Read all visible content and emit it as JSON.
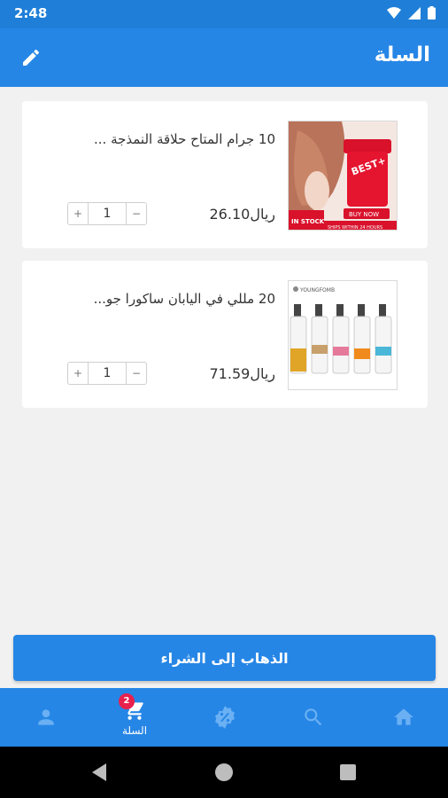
{
  "status_bar": {
    "time": "2:48"
  },
  "app_bar": {
    "title": "السلة",
    "edit_icon": "pencil-icon"
  },
  "cart": {
    "items": [
      {
        "title": "10 جرام المتاح حلاقة النمذجة ...",
        "price": "26.10ريال",
        "quantity": "1",
        "image_text_top": "BEST+",
        "image_text_stock": "IN STOCK",
        "image_text_buy": "BUY NOW",
        "image_text_ship": "SHIPS WITHIN 24 HOURS"
      },
      {
        "title": "20 مللي في اليابان ساكورا جو...",
        "price": "71.59ريال",
        "quantity": "1",
        "image_text_brand": "YOUNGFOMB"
      }
    ],
    "plus": "+",
    "minus": "−"
  },
  "checkout": {
    "label": "الذهاب إلى الشراء"
  },
  "bottom_nav": {
    "cart_label": "السلة",
    "cart_badge": "2"
  },
  "colors": {
    "primary": "#2686e6",
    "status": "#1f7fd8",
    "badge": "#e8214d",
    "background": "#f1f1f1"
  }
}
